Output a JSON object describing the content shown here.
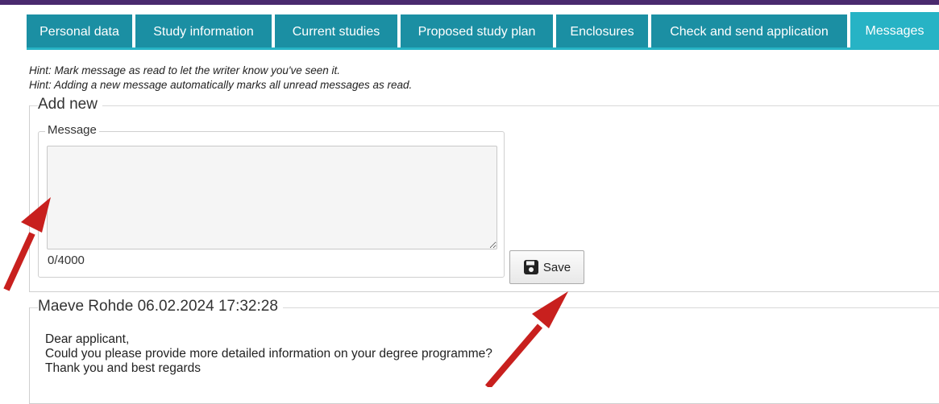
{
  "tabs": [
    {
      "label": "Personal data"
    },
    {
      "label": "Study information"
    },
    {
      "label": "Current studies"
    },
    {
      "label": "Proposed study plan"
    },
    {
      "label": "Enclosures"
    },
    {
      "label": "Check and send application"
    },
    {
      "label": "Messages"
    }
  ],
  "hints": [
    "Hint: Mark message as read to let the writer know you've seen it.",
    "Hint: Adding a new message automatically marks all unread messages as read."
  ],
  "add_new": {
    "title": "Add new",
    "message_legend": "Message",
    "message_value": "",
    "counter": "0/4000",
    "save_label": "Save"
  },
  "message": {
    "header": "Maeve Rohde 06.02.2024 17:32:28",
    "lines": [
      "Dear applicant,",
      "Could you please provide more detailed information on your degree programme?",
      "Thank you and best regards"
    ]
  },
  "colors": {
    "top_bar": "#4a2a6e",
    "tab": "#1b8fa3",
    "tab_active": "#27b3c5",
    "annotation_arrow": "#c8201e"
  }
}
